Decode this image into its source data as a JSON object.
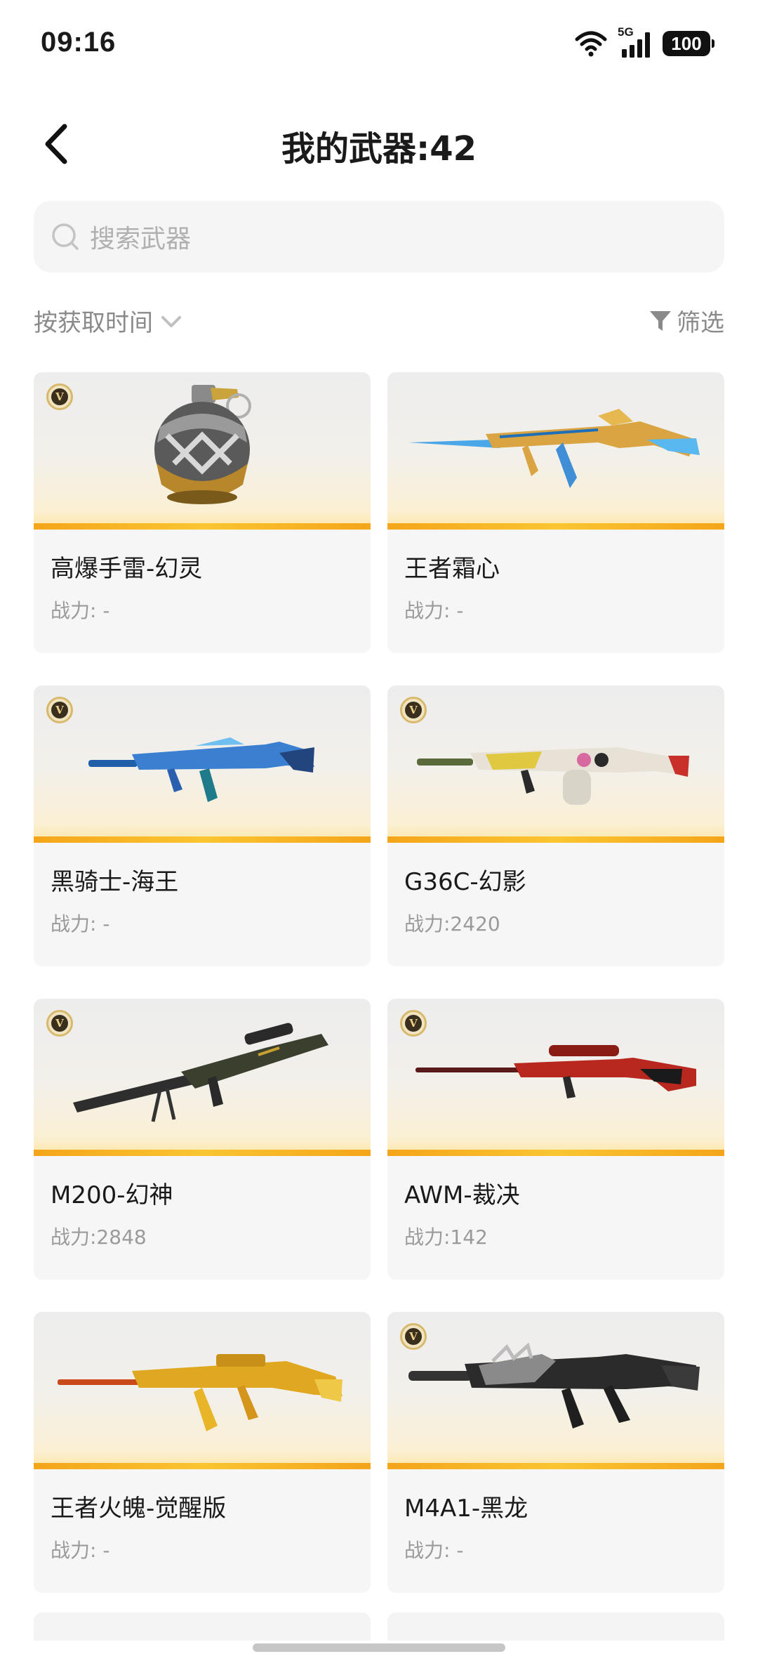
{
  "status": {
    "time": "09:16",
    "network": "5G",
    "battery": "100"
  },
  "header": {
    "title": "我的武器:42"
  },
  "search": {
    "placeholder": "搜索武器"
  },
  "toolbar": {
    "sort_label": "按获取时间",
    "filter_label": "筛选"
  },
  "weapons": [
    {
      "name": "高爆手雷-幻灵",
      "power": "战力: -",
      "vip": true,
      "image": "grenade-image"
    },
    {
      "name": "王者霜心",
      "power": "战力: -",
      "vip": false,
      "image": "rifle-image"
    },
    {
      "name": "黑骑士-海王",
      "power": "战力: -",
      "vip": true,
      "image": "rifle-image"
    },
    {
      "name": "G36C-幻影",
      "power": "战力:2420",
      "vip": true,
      "image": "rifle-image"
    },
    {
      "name": "M200-幻神",
      "power": "战力:2848",
      "vip": true,
      "image": "sniper-rifle-image"
    },
    {
      "name": "AWM-裁决",
      "power": "战力:142",
      "vip": true,
      "image": "sniper-rifle-image"
    },
    {
      "name": "王者火魄-觉醒版",
      "power": "战力: -",
      "vip": false,
      "image": "rifle-image"
    },
    {
      "name": "M4A1-黑龙",
      "power": "战力: -",
      "vip": true,
      "image": "rifle-image"
    }
  ],
  "badge": {
    "text": "V"
  },
  "colors": {
    "accent_bar": "#f4a51a",
    "muted_text": "#9a9a9a",
    "card_bg": "#f6f6f6"
  }
}
